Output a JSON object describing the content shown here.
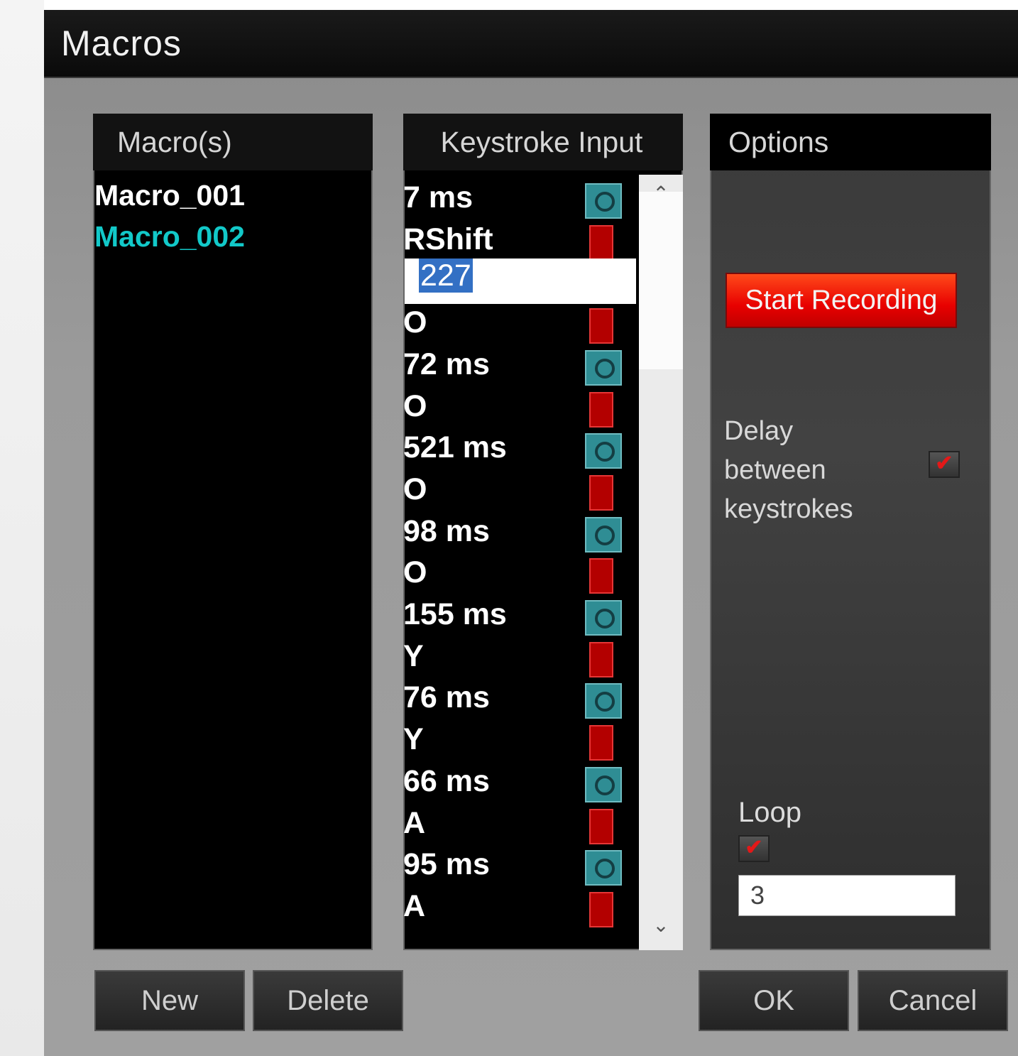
{
  "window": {
    "title": "Macros"
  },
  "macros_panel": {
    "header": "Macro(s)",
    "items": [
      {
        "label": "Macro_001",
        "color": "#ffffff"
      },
      {
        "label": "Macro_002",
        "color": "#12c9c9"
      }
    ]
  },
  "keystroke_panel": {
    "header": "Keystroke Input",
    "edit_value": "227",
    "rows": [
      {
        "text": "7 ms",
        "icon": "clock-icon"
      },
      {
        "text": "RShift",
        "icon": "key-icon"
      },
      {
        "text": "",
        "icon": ""
      },
      {
        "text": "O",
        "icon": "key-icon"
      },
      {
        "text": "72 ms",
        "icon": "clock-icon"
      },
      {
        "text": "O",
        "icon": "key-icon"
      },
      {
        "text": "521 ms",
        "icon": "clock-icon"
      },
      {
        "text": "O",
        "icon": "key-icon"
      },
      {
        "text": "98 ms",
        "icon": "clock-icon"
      },
      {
        "text": "O",
        "icon": "key-icon"
      },
      {
        "text": "155 ms",
        "icon": "clock-icon"
      },
      {
        "text": "Y",
        "icon": "key-icon"
      },
      {
        "text": "76 ms",
        "icon": "clock-icon"
      },
      {
        "text": "Y",
        "icon": "key-icon"
      },
      {
        "text": "66 ms",
        "icon": "clock-icon"
      },
      {
        "text": "A",
        "icon": "key-icon"
      },
      {
        "text": "95 ms",
        "icon": "clock-icon"
      },
      {
        "text": "A",
        "icon": "key-icon"
      }
    ],
    "scroll_up_glyph": "⌃",
    "scroll_down_glyph": "⌄"
  },
  "options_panel": {
    "header": "Options",
    "record_label": "Start Recording",
    "delay_label": "Delay between keystrokes",
    "delay_checked": true,
    "loop_label": "Loop",
    "loop_checked": true,
    "loop_count": "3",
    "check_glyph": "✔"
  },
  "buttons": {
    "new": "New",
    "delete": "Delete",
    "ok": "OK",
    "cancel": "Cancel"
  },
  "colors": {
    "accent_record": "#ff2a00",
    "clock_icon": "#2f8d94",
    "key_icon": "#b30000",
    "selected_macro": "#12c9c9"
  }
}
